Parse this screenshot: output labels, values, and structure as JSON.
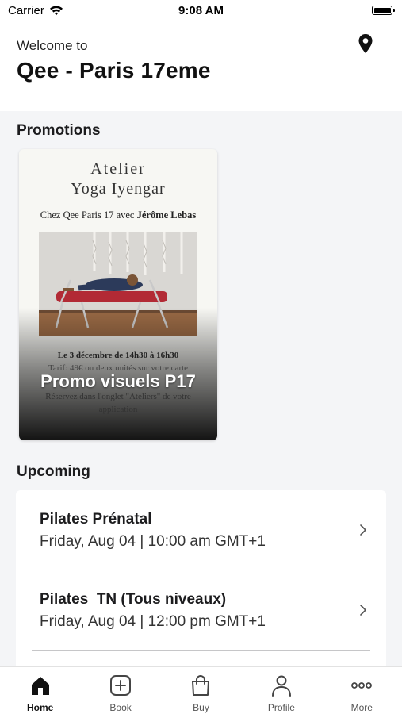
{
  "status_bar": {
    "carrier": "Carrier",
    "time": "9:08 AM"
  },
  "header": {
    "welcome": "Welcome to",
    "location": "Qee - Paris 17eme",
    "icon": "location-pin-icon"
  },
  "promotions": {
    "title": "Promotions",
    "cards": [
      {
        "caption": "Promo visuels P17",
        "poster": {
          "line1": "Atelier",
          "line2": "Yoga Iyengar",
          "subtitle_prefix": "Chez Qee Paris 17 avec ",
          "subtitle_name": "Jérôme Lebas",
          "date": "Le 3 décembre de 14h30 à 16h30",
          "tarif": "Tarif: 49€ ou deux unités sur votre carte",
          "reserve": "Réservez dans l'onglet \"Ateliers\" de votre",
          "app": "application"
        }
      }
    ]
  },
  "upcoming": {
    "title": "Upcoming",
    "items": [
      {
        "name": "Pilates Prénatal",
        "time": "Friday, Aug 04 | 10:00 am GMT+1"
      },
      {
        "name": "Pilates  TN (Tous niveaux)",
        "time": "Friday, Aug 04 | 12:00 pm GMT+1"
      }
    ]
  },
  "tab_bar": {
    "tabs": [
      {
        "label": "Home",
        "icon": "home-icon",
        "active": true
      },
      {
        "label": "Book",
        "icon": "plus-square-icon",
        "active": false
      },
      {
        "label": "Buy",
        "icon": "shopping-bag-icon",
        "active": false
      },
      {
        "label": "Profile",
        "icon": "person-icon",
        "active": false
      },
      {
        "label": "More",
        "icon": "more-dots-icon",
        "active": false
      }
    ]
  }
}
